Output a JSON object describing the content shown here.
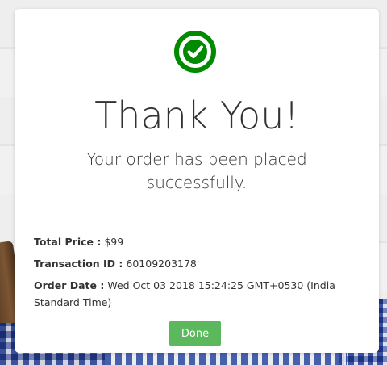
{
  "confirmation": {
    "title": "Thank You!",
    "message": "Your order has been placed successfully.",
    "icon": "check-circle-icon",
    "icon_color": "#008a00"
  },
  "order": {
    "total_price_label": "Total Price :",
    "total_price_value": "$99",
    "transaction_id_label": "Transaction ID :",
    "transaction_id_value": "60109203178",
    "order_date_label": "Order Date :",
    "order_date_value": "Wed Oct 03 2018 15:24:25 GMT+0530 (India Standard Time)"
  },
  "actions": {
    "done_label": "Done",
    "done_color": "#5cb85c"
  }
}
